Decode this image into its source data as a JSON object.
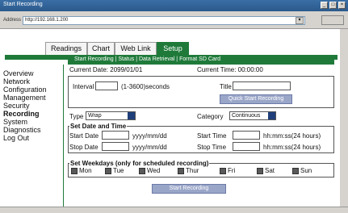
{
  "window": {
    "title": "Start Recording"
  },
  "address": {
    "label": "Address",
    "url": "http://192.168.1.200"
  },
  "tabs": [
    "Readings",
    "Chart",
    "Web Link",
    "Setup"
  ],
  "subnav": [
    "Start Recording",
    "Status",
    "Data Retrieval",
    "Format SD Card"
  ],
  "sidebar": [
    "Overview",
    "Network",
    "Configuration",
    "Management",
    "Security",
    "Recording",
    "System",
    "Diagnostics",
    "Log Out"
  ],
  "current_date": "Current Date: 2099/01/01",
  "current_time": "Current Time: 00:00:00",
  "interval": {
    "label": "Interval",
    "hint": "(1-3600)seconds"
  },
  "title_field": {
    "label": "Title"
  },
  "quick_start": "Quick Start Recording",
  "type": {
    "label": "Type",
    "value": "Wrap"
  },
  "category": {
    "label": "Category",
    "value": "Continuous"
  },
  "date_time": {
    "section": "Set Date and Time",
    "start_date": "Start Date",
    "stop_date": "Stop Date",
    "date_fmt": "yyyy/mm/dd",
    "start_time": "Start Time",
    "stop_time": "Stop Time",
    "time_fmt": "hh:mm:ss(24 hours)"
  },
  "weekdays": {
    "section": "Set Weekdays (only for scheduled recording)",
    "days": [
      "Mon",
      "Tue",
      "Wed",
      "Thur",
      "Fri",
      "Sat",
      "Sun"
    ]
  },
  "start_recording": "Start Recording",
  "colors": {
    "accent": "#1f7a3a",
    "button": "#9aa6c8",
    "chrome": "#d6d3ce"
  }
}
